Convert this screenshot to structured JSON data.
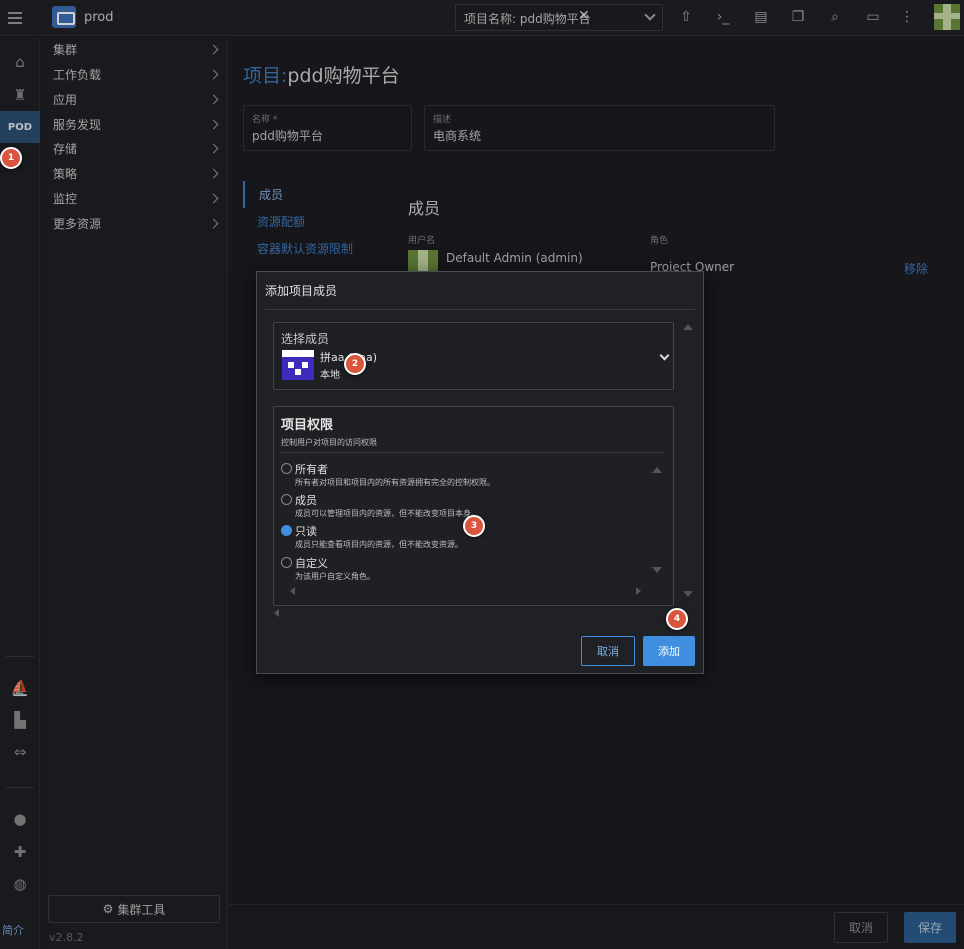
{
  "topbar": {
    "cluster_name": "prod",
    "filter_chip": "项目名称: pdd购物平台",
    "filter_clear": "✕",
    "icons": [
      "upload-icon",
      "terminal-icon",
      "file-icon",
      "copy-icon",
      "search-icon",
      "book-icon",
      "more-icon"
    ]
  },
  "rail": {
    "pod_label": "POD",
    "jianjie": "简介"
  },
  "nav": {
    "items": [
      {
        "label": "集群"
      },
      {
        "label": "工作负载"
      },
      {
        "label": "应用"
      },
      {
        "label": "服务发现"
      },
      {
        "label": "存储"
      },
      {
        "label": "策略"
      },
      {
        "label": "监控"
      },
      {
        "label": "更多资源"
      }
    ],
    "cluster_tools": "集群工具",
    "version": "v2.8.2"
  },
  "main": {
    "title_prefix": "项目:",
    "title_name": "pdd购物平台",
    "name_label": "名称 *",
    "name_value": "pdd购物平台",
    "desc_label": "描述",
    "desc_value": "电商系统",
    "tabs": [
      "成员",
      "资源配额",
      "容器默认资源限制"
    ],
    "members_title": "成员",
    "col_username": "用户名",
    "col_role": "角色",
    "member_name": "Default Admin (admin)",
    "member_role": "Project Owner",
    "member_remove": "移除",
    "cancel": "取消",
    "save": "保存"
  },
  "modal": {
    "title": "添加项目成员",
    "select_label": "选择成员",
    "user_name": "拼aa (paa)",
    "user_source": "本地",
    "perm_title": "项目权限",
    "perm_desc": "控制用户对项目的访问权限",
    "options": [
      {
        "label": "所有者",
        "desc": "所有者对项目和项目内的所有资源拥有完全的控制权限。",
        "checked": false
      },
      {
        "label": "成员",
        "desc": "成员可以管理项目内的资源，但不能改变项目本身。",
        "checked": false
      },
      {
        "label": "只读",
        "desc": "成员只能查看项目内的资源，但不能改变资源。",
        "checked": true
      },
      {
        "label": "自定义",
        "desc": "为该用户自定义角色。",
        "checked": false
      }
    ],
    "cancel": "取消",
    "add": "添加"
  },
  "steps": [
    "1",
    "2",
    "3",
    "4"
  ],
  "colors": {
    "accent": "#3f8ee0",
    "step_marker": "#d9553d",
    "background": "#1b1c21"
  }
}
